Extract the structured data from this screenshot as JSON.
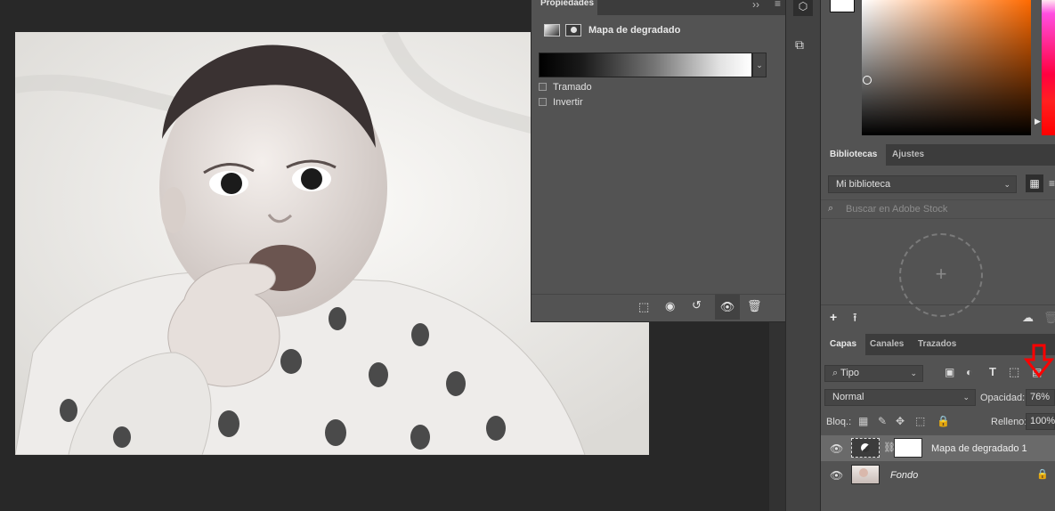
{
  "properties": {
    "tab_label": "Propiedades",
    "title": "Mapa de degradado",
    "dither_label": "Tramado",
    "invert_label": "Invertir"
  },
  "libraries": {
    "tabs": [
      "Bibliotecas",
      "Ajustes"
    ],
    "selected_library": "Mi biblioteca",
    "search_placeholder": "Buscar en Adobe Stock"
  },
  "layers": {
    "tabs": [
      "Capas",
      "Canales",
      "Trazados"
    ],
    "filter_kind": "Tipo",
    "blend_mode": "Normal",
    "opacity_label": "Opacidad:",
    "opacity_value": "76%",
    "lock_label": "Bloq.:",
    "fill_label": "Relleno:",
    "fill_value": "100%",
    "items": [
      {
        "name": "Mapa de degradado 1",
        "selected": true
      },
      {
        "name": "Fondo",
        "selected": false,
        "locked": true
      }
    ]
  },
  "colors": {
    "accent_arrow": "#ff0000",
    "panel_bg": "#535353"
  }
}
